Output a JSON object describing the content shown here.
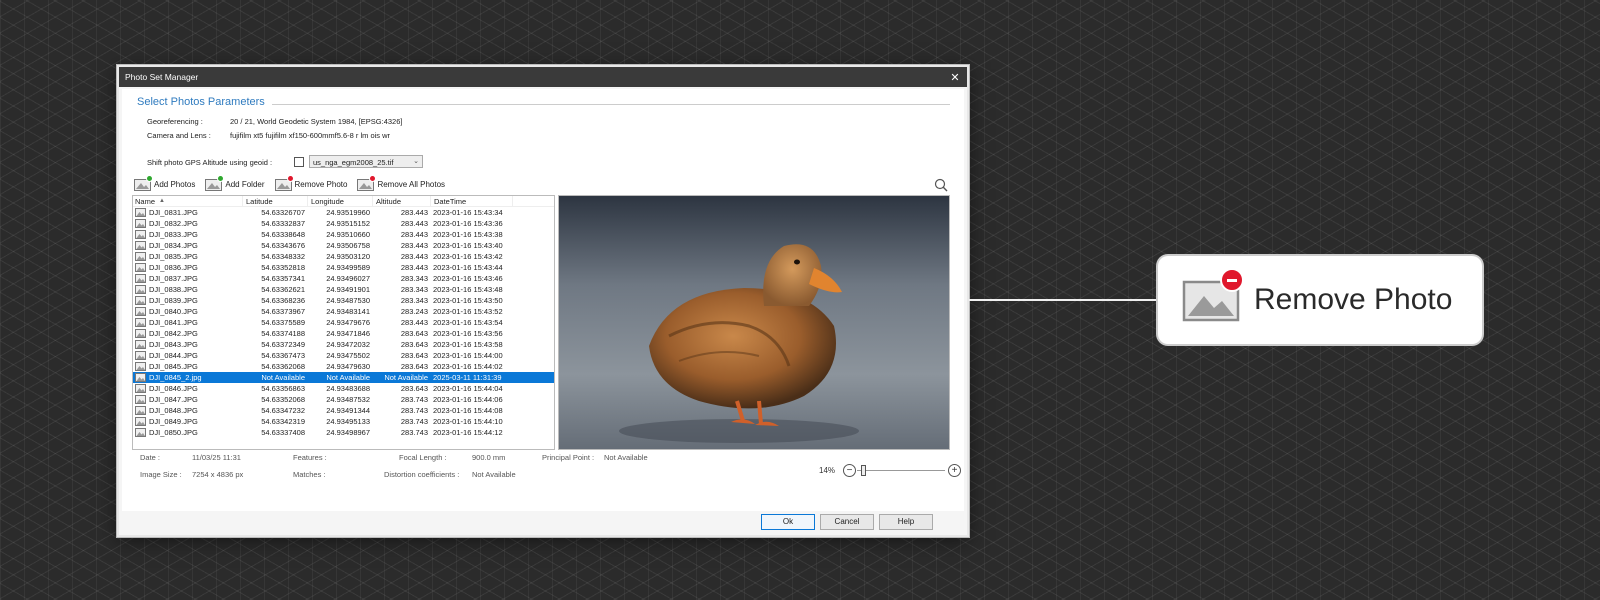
{
  "dialog": {
    "title": "Photo Set Manager",
    "close_glyph": "✕"
  },
  "params": {
    "section_title": "Select Photos Parameters",
    "georef_label": "Georeferencing :",
    "georef_value": "20 / 21, World Geodetic System 1984, [EPSG:4326]",
    "camera_label": "Camera and Lens :",
    "camera_value": "fujifilm xt5 fujifilm xf150-600mmf5.6-8 r lm ois wr",
    "shift_label": "Shift photo GPS Altitude using geoid :",
    "shift_checked": false,
    "geoid_selected": "us_nga_egm2008_25.tif"
  },
  "toolbar": {
    "add_photos": "Add Photos",
    "add_folder": "Add Folder",
    "remove_photo": "Remove Photo",
    "remove_all": "Remove All Photos"
  },
  "table": {
    "columns": [
      "Name",
      "Latitude",
      "Longitude",
      "Altitude",
      "DateTime"
    ],
    "rows": [
      {
        "name": "DJI_0831.JPG",
        "lat": "54.63326707",
        "lon": "24.93519960",
        "alt": "283.443",
        "dt": "2023-01-16 15:43:34"
      },
      {
        "name": "DJI_0832.JPG",
        "lat": "54.63332837",
        "lon": "24.93515152",
        "alt": "283.443",
        "dt": "2023-01-16 15:43:36"
      },
      {
        "name": "DJI_0833.JPG",
        "lat": "54.63338648",
        "lon": "24.93510660",
        "alt": "283.443",
        "dt": "2023-01-16 15:43:38"
      },
      {
        "name": "DJI_0834.JPG",
        "lat": "54.63343676",
        "lon": "24.93506758",
        "alt": "283.443",
        "dt": "2023-01-16 15:43:40"
      },
      {
        "name": "DJI_0835.JPG",
        "lat": "54.63348332",
        "lon": "24.93503120",
        "alt": "283.443",
        "dt": "2023-01-16 15:43:42"
      },
      {
        "name": "DJI_0836.JPG",
        "lat": "54.63352818",
        "lon": "24.93499589",
        "alt": "283.443",
        "dt": "2023-01-16 15:43:44"
      },
      {
        "name": "DJI_0837.JPG",
        "lat": "54.63357341",
        "lon": "24.93496027",
        "alt": "283.343",
        "dt": "2023-01-16 15:43:46"
      },
      {
        "name": "DJI_0838.JPG",
        "lat": "54.63362621",
        "lon": "24.93491901",
        "alt": "283.343",
        "dt": "2023-01-16 15:43:48"
      },
      {
        "name": "DJI_0839.JPG",
        "lat": "54.63368236",
        "lon": "24.93487530",
        "alt": "283.343",
        "dt": "2023-01-16 15:43:50"
      },
      {
        "name": "DJI_0840.JPG",
        "lat": "54.63373967",
        "lon": "24.93483141",
        "alt": "283.243",
        "dt": "2023-01-16 15:43:52"
      },
      {
        "name": "DJI_0841.JPG",
        "lat": "54.63375589",
        "lon": "24.93479676",
        "alt": "283.443",
        "dt": "2023-01-16 15:43:54"
      },
      {
        "name": "DJI_0842.JPG",
        "lat": "54.63374188",
        "lon": "24.93471846",
        "alt": "283.643",
        "dt": "2023-01-16 15:43:56"
      },
      {
        "name": "DJI_0843.JPG",
        "lat": "54.63372349",
        "lon": "24.93472032",
        "alt": "283.643",
        "dt": "2023-01-16 15:43:58"
      },
      {
        "name": "DJI_0844.JPG",
        "lat": "54.63367473",
        "lon": "24.93475502",
        "alt": "283.643",
        "dt": "2023-01-16 15:44:00"
      },
      {
        "name": "DJI_0845.JPG",
        "lat": "54.63362068",
        "lon": "24.93479630",
        "alt": "283.643",
        "dt": "2023-01-16 15:44:02"
      },
      {
        "name": "DJI_0845_2.jpg",
        "lat": "Not Available",
        "lon": "Not Available",
        "alt": "Not Available",
        "dt": "2025-03-11 11:31:39",
        "selected": true
      },
      {
        "name": "DJI_0846.JPG",
        "lat": "54.63356863",
        "lon": "24.93483688",
        "alt": "283.643",
        "dt": "2023-01-16 15:44:04"
      },
      {
        "name": "DJI_0847.JPG",
        "lat": "54.63352068",
        "lon": "24.93487532",
        "alt": "283.743",
        "dt": "2023-01-16 15:44:06"
      },
      {
        "name": "DJI_0848.JPG",
        "lat": "54.63347232",
        "lon": "24.93491344",
        "alt": "283.743",
        "dt": "2023-01-16 15:44:08"
      },
      {
        "name": "DJI_0849.JPG",
        "lat": "54.63342319",
        "lon": "24.93495133",
        "alt": "283.743",
        "dt": "2023-01-16 15:44:10"
      },
      {
        "name": "DJI_0850.JPG",
        "lat": "54.63337408",
        "lon": "24.93498967",
        "alt": "283.743",
        "dt": "2023-01-16 15:44:12"
      }
    ]
  },
  "info": {
    "date_label": "Date :",
    "date_value": "11/03/25 11:31",
    "features_label": "Features :",
    "focal_label": "Focal Length :",
    "focal_value": "900.0 mm",
    "principal_label": "Principal Point :",
    "principal_value": "Not Available",
    "size_label": "Image Size :",
    "size_value": "7254 x 4836 px",
    "matches_label": "Matches :",
    "distortion_label": "Distortion coefficients :",
    "distortion_value": "Not Available"
  },
  "zoom": {
    "level": "14%",
    "minus": "−",
    "plus": "+"
  },
  "buttons": {
    "ok": "Ok",
    "cancel": "Cancel",
    "help": "Help"
  },
  "callout": {
    "label": "Remove Photo"
  },
  "colors": {
    "accent": "#0a78d7",
    "title_blue": "#2f7bbf",
    "remove_badge": "#e0182d",
    "add_badge": "#2fa82f"
  }
}
